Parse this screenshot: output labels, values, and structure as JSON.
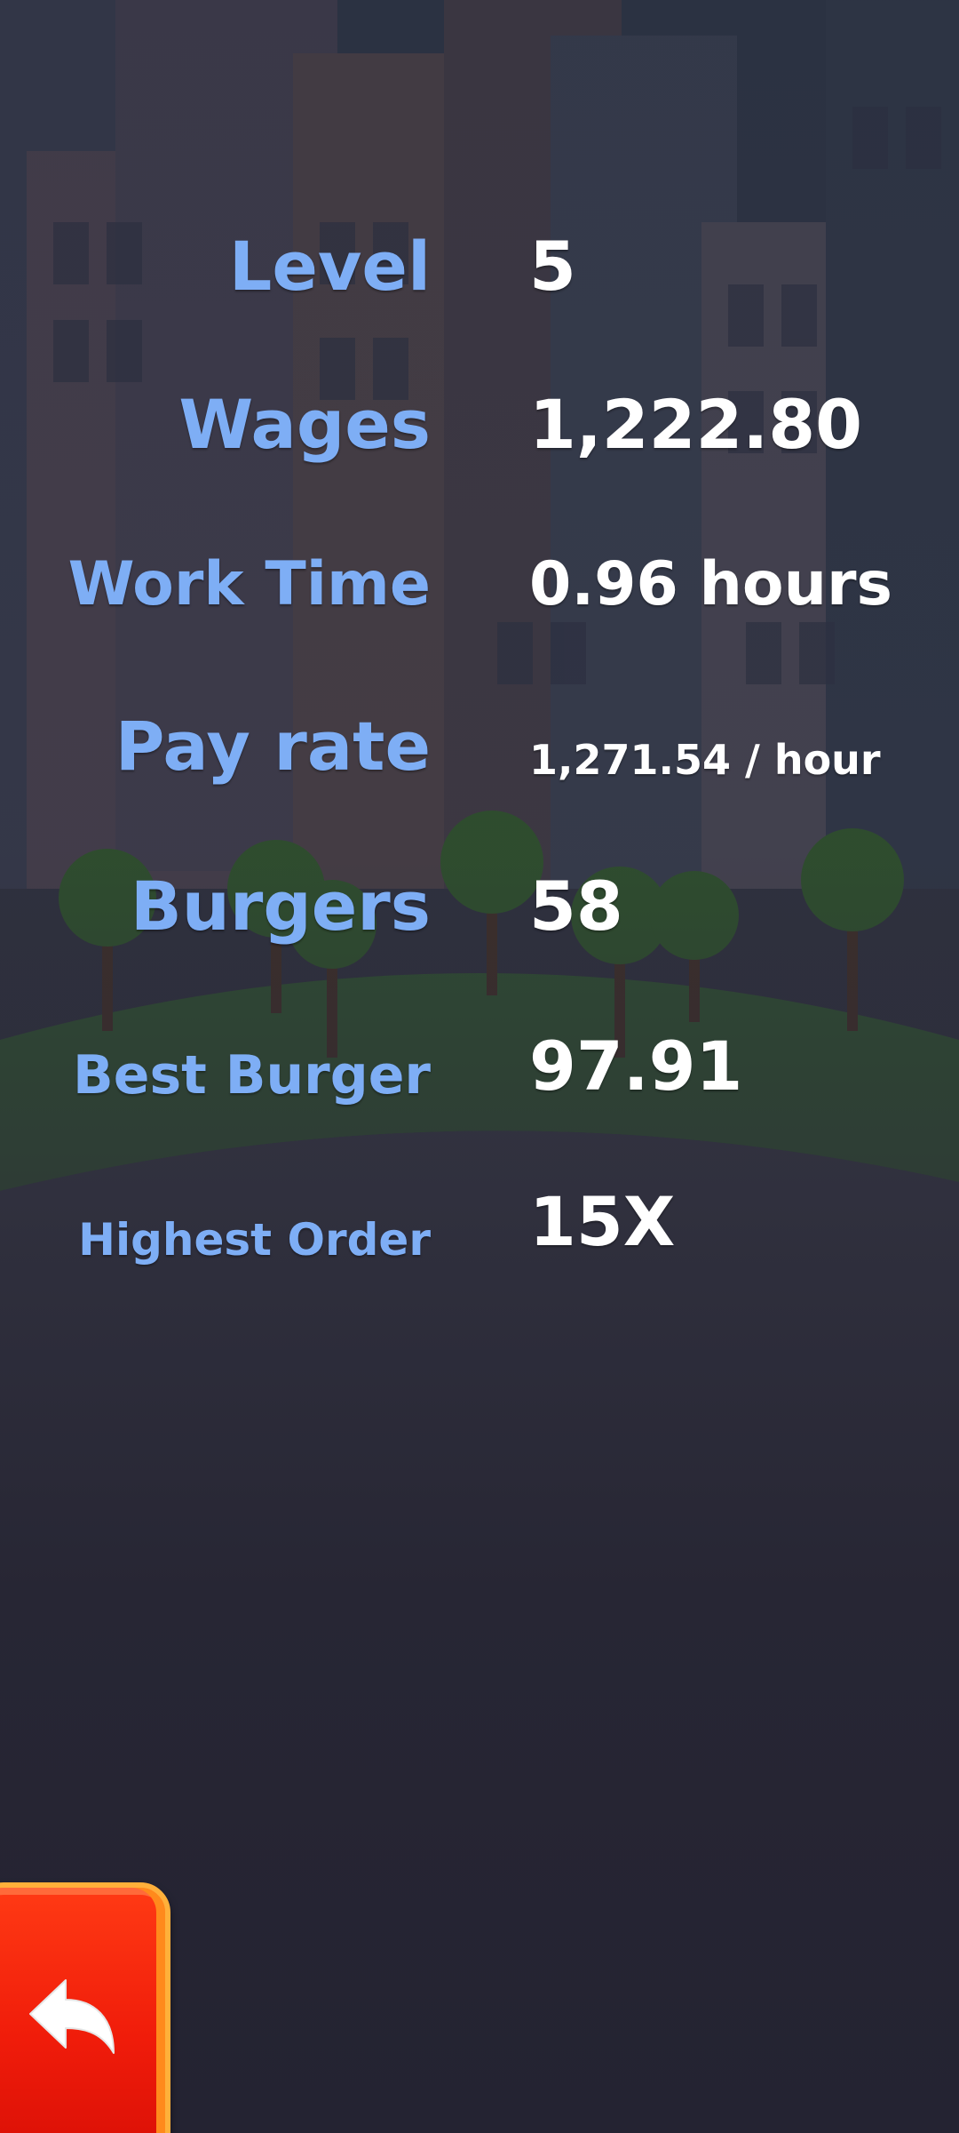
{
  "stats": {
    "level": {
      "label": "Level",
      "value": "5"
    },
    "wages": {
      "label": "Wages",
      "value": "1,222.80"
    },
    "work_time": {
      "label": "Work Time",
      "value": "0.96 hours"
    },
    "pay_rate": {
      "label": "Pay rate",
      "value": "1,271.54 / hour"
    },
    "burgers": {
      "label": "Burgers",
      "value": "58"
    },
    "best_burger": {
      "label": "Best Burger",
      "value": "97.91"
    },
    "highest_order": {
      "label": "Highest Order",
      "value": "15X"
    }
  },
  "back_button": {
    "icon": "back-arrow-icon"
  },
  "colors": {
    "label": "#7eaef5",
    "value": "#ffffff",
    "back_button": "#f01c0a",
    "background": "#25243a"
  }
}
